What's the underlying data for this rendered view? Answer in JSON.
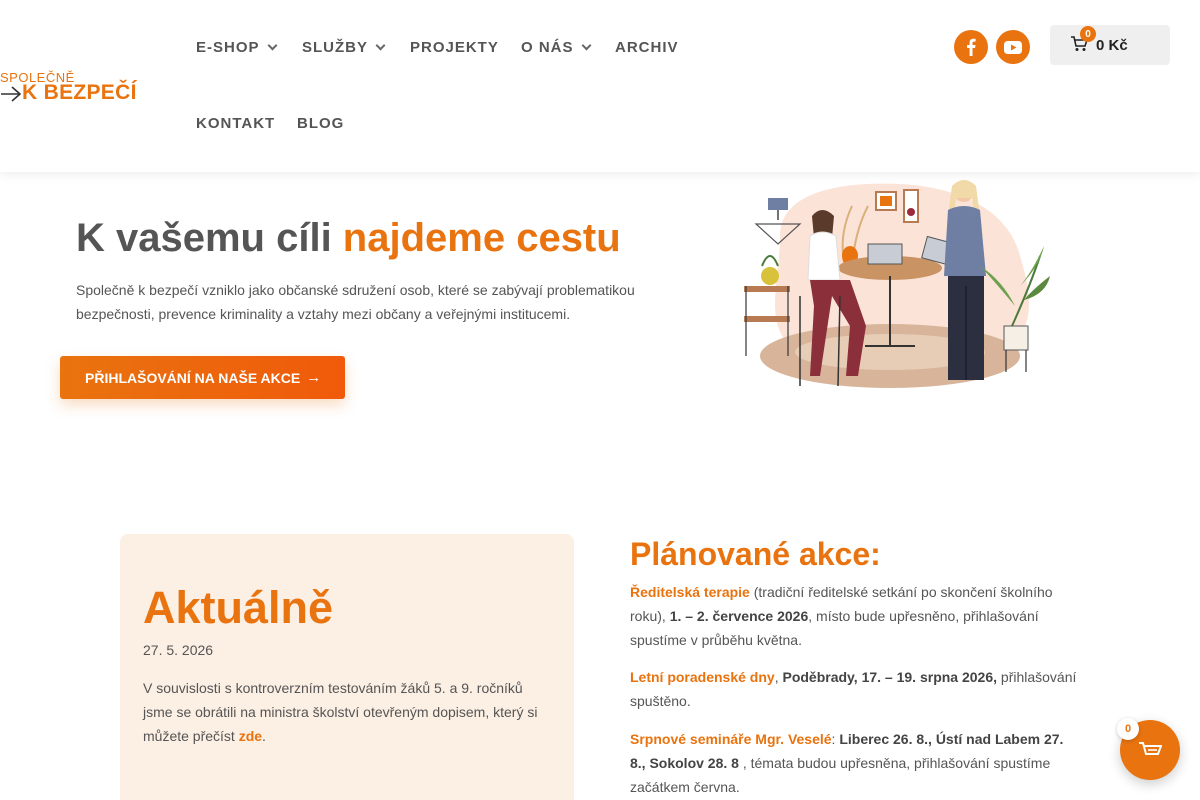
{
  "colors": {
    "accent": "#e9730f",
    "card_bg": "#fcefe4",
    "text": "#555555"
  },
  "logo": {
    "line1": "SPOLEČNĚ",
    "line2": "K BEZPEČÍ"
  },
  "nav": {
    "eshop": "E-SHOP",
    "sluzby": "SLUŽBY",
    "projekty": "PROJEKTY",
    "onas": "O NÁS",
    "archiv": "ARCHIV",
    "kontakt": "KONTAKT",
    "blog": "BLOG"
  },
  "social": [
    {
      "icon": "facebook-icon"
    },
    {
      "icon": "youtube-icon"
    }
  ],
  "cart": {
    "count": "0",
    "price": "0 Kč"
  },
  "hero": {
    "title_plain": "K vašemu cíli ",
    "title_accent": "najdeme cestu",
    "text": "Společně k bezpečí vzniklo jako občanské sdružení osob, které se zabývají problematikou bezpečnosti, prevence kriminality a vztahy mezi občany a veřejnými institucemi.",
    "button": "PŘIHLAŠOVÁNÍ NA NAŠE AKCE",
    "button_arrow": "→"
  },
  "news": {
    "title": "Aktuálně",
    "date": "27. 5. 2026",
    "text": "V souvislosti s kontroverzním testováním žáků 5. a 9. ročníků jsme se obrátili na ministra školství otevřeným dopisem, který si můžete přečíst ",
    "link": "zde",
    "suffix": "."
  },
  "planned": {
    "title": "Plánované akce:",
    "items": [
      {
        "name": "Ředitelská terapie",
        "t1": " (tradiční ředitelské setkání po skončení školního roku), ",
        "bold": "1. – 2. července 2026",
        "t2": ", místo bude upřesněno, přihlašování spustíme v průběhu května."
      },
      {
        "name": "Letní poradenské dny",
        "t1": ", ",
        "bold": "Poděbrady, 17. – 19. srpna 2026,",
        "t2": " přihlašování spuštěno."
      },
      {
        "name": "Srpnové semináře Mgr. Veselé",
        "t1": ": ",
        "bold": "Liberec 26. 8., Ústí nad Labem 27. 8., Sokolov 28. 8",
        "t2": " , témata budou upřesněna, přihlašování spustíme začátkem června."
      }
    ]
  },
  "floating_cart": {
    "count": "0"
  }
}
